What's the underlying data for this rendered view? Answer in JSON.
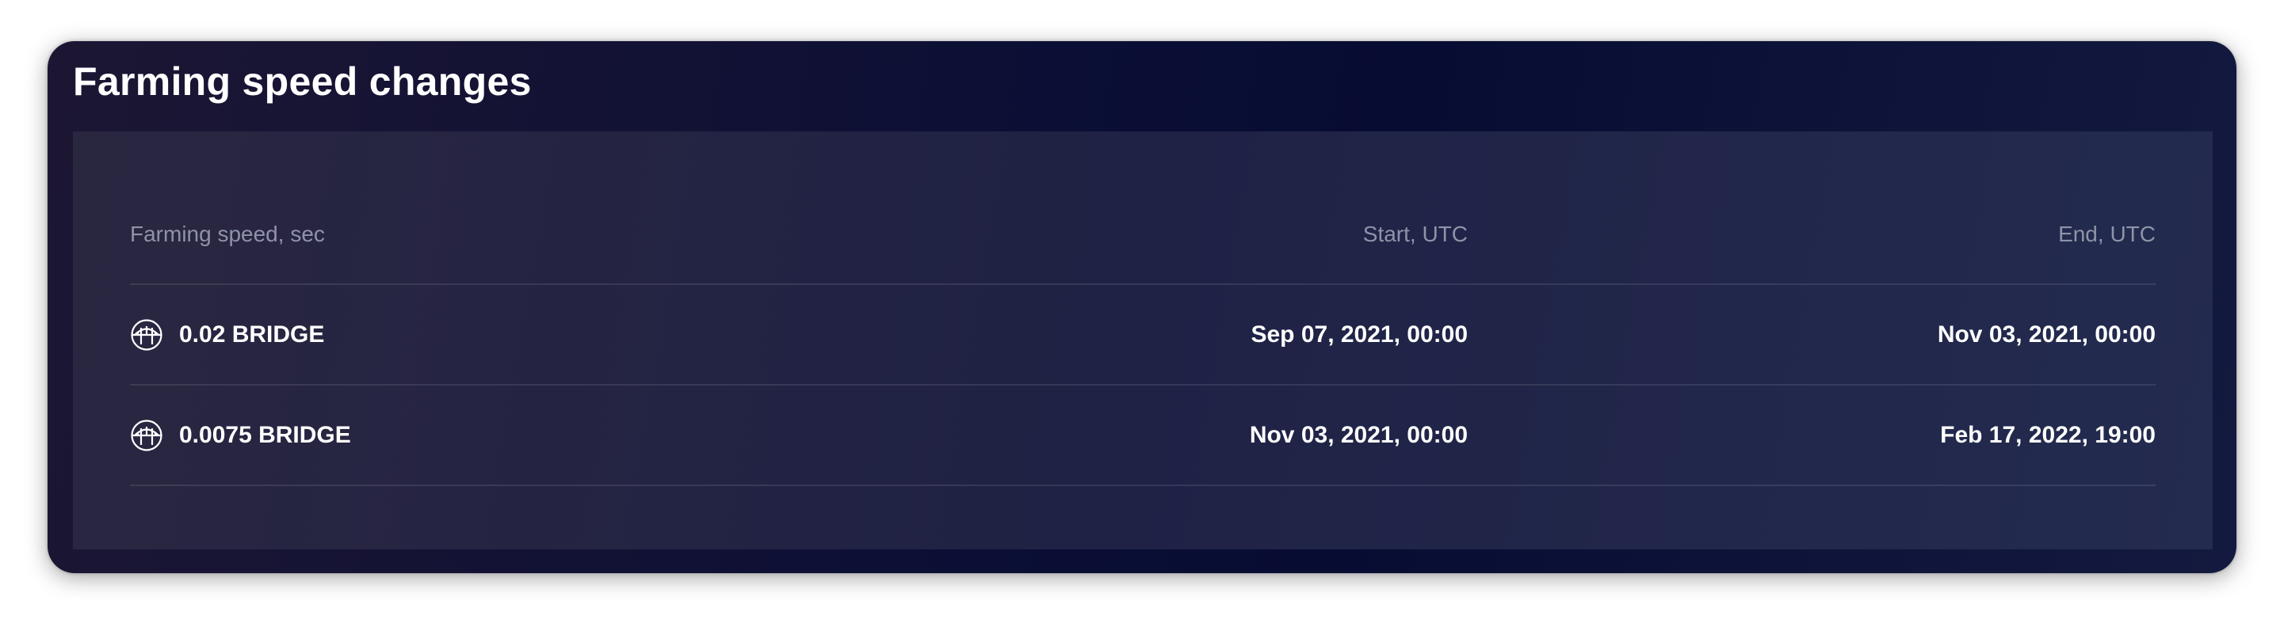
{
  "card": {
    "title": "Farming speed changes"
  },
  "table": {
    "columns": {
      "speed": "Farming speed, sec",
      "start": "Start, UTC",
      "end": "End, UTC"
    },
    "rows": [
      {
        "icon": "bridge-token-icon",
        "speed": "0.02 BRIDGE",
        "start": "Sep 07, 2021, 00:00",
        "end": "Nov 03, 2021, 00:00"
      },
      {
        "icon": "bridge-token-icon",
        "speed": "0.0075 BRIDGE",
        "start": "Nov 03, 2021, 00:00",
        "end": "Feb 17, 2022, 19:00"
      }
    ]
  },
  "colors": {
    "card_background": "#0b0f35",
    "panel_background": "#1f2245",
    "header_text": "#8f93a8",
    "value_text": "#ffffff"
  }
}
